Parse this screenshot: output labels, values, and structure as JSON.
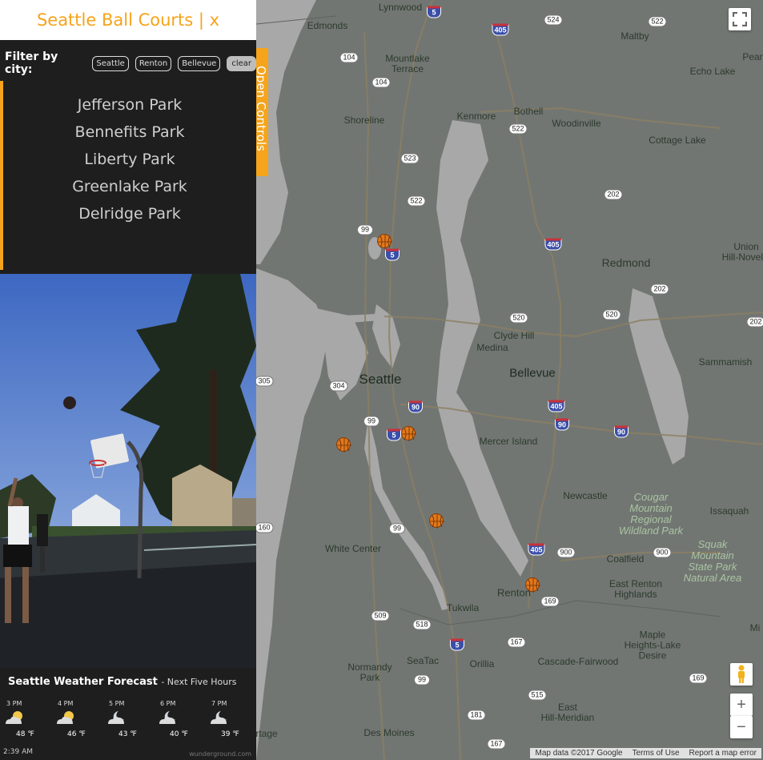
{
  "sidebar": {
    "title": "Seattle Ball Courts | x",
    "filter_label": "Filter by city:",
    "cities": [
      "Seattle",
      "Renton",
      "Bellevue"
    ],
    "clear_label": "clear",
    "parks": [
      "Jefferson Park",
      "Bennefits Park",
      "Liberty Park",
      "Greenlake Park",
      "Delridge Park"
    ],
    "open_controls_label": "Open Controls",
    "accent_color": "#f5a41b"
  },
  "weather": {
    "title": "Seattle Weather Forecast",
    "subtitle": "- Next Five Hours",
    "hours": [
      {
        "time": "3 PM",
        "temp": "48 ℉",
        "icon": "partly-cloudy-icon"
      },
      {
        "time": "4 PM",
        "temp": "46 ℉",
        "icon": "partly-cloudy-icon"
      },
      {
        "time": "5 PM",
        "temp": "43 ℉",
        "icon": "partly-cloudy-night-icon"
      },
      {
        "time": "6 PM",
        "temp": "40 ℉",
        "icon": "partly-cloudy-night-icon"
      },
      {
        "time": "7 PM",
        "temp": "39 ℉",
        "icon": "partly-cloudy-night-icon"
      }
    ],
    "updated": "2:39 AM",
    "credit": "wunderground.com"
  },
  "map": {
    "labels": {
      "lynnwood": "Lynnwood",
      "edmonds": "Edmonds",
      "maltby": "Maltby",
      "mountlake": "Mountlake\nTerrace",
      "echo_lake": "Echo Lake",
      "shoreline": "Shoreline",
      "kenmore": "Kenmore",
      "bothell": "Bothell",
      "woodinville": "Woodinville",
      "cottage_lake": "Cottage Lake",
      "redmond": "Redmond",
      "union_hill": "Union\nHill-Novelty",
      "clyde_hill": "Clyde Hill",
      "medina": "Medina",
      "seattle": "Seattle",
      "bellevue": "Bellevue",
      "sammamish": "Sammamish",
      "mercer_island": "Mercer Island",
      "newcastle": "Newcastle",
      "issaquah": "Issaquah",
      "cougar": "Cougar\nMountain\nRegional\nWildland Park",
      "white_center": "White Center",
      "coalfield": "Coalfield",
      "squak": "Squak\nMountain\nState Park\nNatural Area",
      "east_renton": "East Renton\nHighlands",
      "renton": "Renton",
      "tukwila": "Tukwila",
      "maple": "Maple\nHeights-Lake\nDesire",
      "seatac": "SeaTac",
      "orillia": "Orillia",
      "cascade": "Cascade-Fairwood",
      "normandy": "Normandy\nPark",
      "east_hill": "East\nHill-Meridian",
      "des_moines": "Des Moines",
      "burien_edge": "rtage",
      "pear": "Pear",
      "mi": "Mi"
    },
    "shields": {
      "s5a": "5",
      "s405a": "405",
      "s524": "524",
      "s522a": "522",
      "s104a": "104",
      "s104b": "104",
      "s522b": "522",
      "s523": "523",
      "s522c": "522",
      "s202a": "202",
      "s99a": "99",
      "s5b": "5",
      "s405b": "405",
      "s202b": "202",
      "s520a": "520",
      "s520b": "520",
      "s202c": "202",
      "s305": "305",
      "s304": "304",
      "s90a": "90",
      "s405c": "405",
      "s99b": "99",
      "s5c": "5",
      "s90b": "90",
      "s90c": "90",
      "s160": "160",
      "s99c": "99",
      "s405d": "405",
      "s900a": "900",
      "s900b": "900",
      "s169a": "169",
      "s509": "509",
      "s518": "518",
      "s5d": "5",
      "s167a": "167",
      "s99d": "99",
      "s515": "515",
      "s181": "181",
      "s169b": "169",
      "s167b": "167"
    },
    "attribution": [
      "Map data ©2017 Google",
      "Terms of Use",
      "Report a map error"
    ],
    "zoom_in_label": "+",
    "zoom_out_label": "−"
  }
}
